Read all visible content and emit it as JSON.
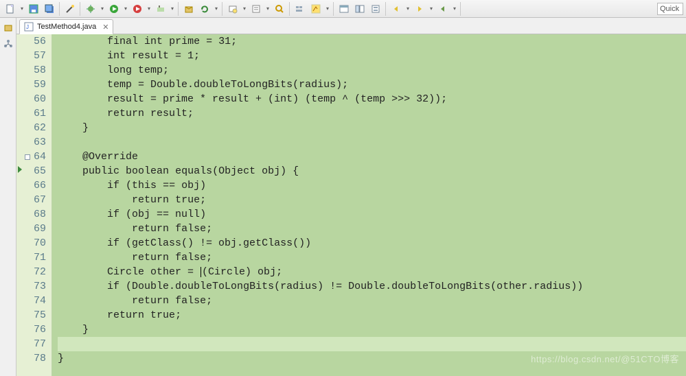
{
  "toolbar": {
    "icons": [
      "new-icon",
      "dd",
      "save-icon",
      "save-all-icon",
      "sep",
      "wand-icon",
      "sep",
      "debug-config-icon",
      "dd",
      "run-icon",
      "dd",
      "run-last-icon",
      "dd",
      "ext-tools-icon",
      "dd",
      "sep",
      "new-package-icon",
      "refresh-icon",
      "dd",
      "sep",
      "open-type-icon",
      "dd",
      "open-task-icon",
      "dd",
      "search-icon",
      "sep",
      "toggle-breadcrumb-icon",
      "highlight-icon",
      "dd",
      "sep",
      "window-icon",
      "layout-icon",
      "outline-icon",
      "sep",
      "back-icon",
      "dd",
      "forward-icon",
      "dd",
      "nav-back-icon",
      "dd",
      "sep"
    ],
    "quick_label": "Quick"
  },
  "leftStrip": [
    "package-explorer-icon",
    "type-hierarchy-icon"
  ],
  "tab": {
    "filename": "TestMethod4.java",
    "close_tooltip": "Close"
  },
  "editor": {
    "lines": [
      {
        "n": 56,
        "t": "        <kw>final</kw> <kw>int</kw> prime = 31;"
      },
      {
        "n": 57,
        "t": "        <kw>int</kw> result = 1;"
      },
      {
        "n": 58,
        "t": "        <kw>long</kw> temp;"
      },
      {
        "n": 59,
        "t": "        temp = Double.<mi>doubleToLongBits</mi>(<ident>radius</ident>);"
      },
      {
        "n": 60,
        "t": "        result = prime * result + (<kw>int</kw>) (temp ^ (temp &gt;&gt;&gt; 32));"
      },
      {
        "n": 61,
        "t": "        <kw>return</kw> result;"
      },
      {
        "n": 62,
        "t": "    }"
      },
      {
        "n": 63,
        "t": ""
      },
      {
        "n": 64,
        "t": "    <ann>@Override</ann>",
        "fold": true
      },
      {
        "n": 65,
        "t": "    <kw>public</kw> <kw>boolean</kw> equals(Object obj) {",
        "marker": true
      },
      {
        "n": 66,
        "t": "        <kw>if</kw> (<kw>this</kw> == obj)"
      },
      {
        "n": 67,
        "t": "            <kw>return</kw> <kw>true</kw>;"
      },
      {
        "n": 68,
        "t": "        <kw>if</kw> (obj == <kw>null</kw>)"
      },
      {
        "n": 69,
        "t": "            <kw>return</kw> <kw>false</kw>;"
      },
      {
        "n": 70,
        "t": "        <kw>if</kw> (getClass() != obj.getClass())"
      },
      {
        "n": 71,
        "t": "            <kw>return</kw> <kw>false</kw>;"
      },
      {
        "n": 72,
        "t": "        Circle other = <span class='cursor-caret'></span>(Circle) obj;"
      },
      {
        "n": 73,
        "t": "        <kw>if</kw> (Double.<mi>doubleToLongBits</mi>(<ident>radius</ident>) != Double.<mi>doubleToLongBits</mi>(other.<ident>radius</ident>))"
      },
      {
        "n": 74,
        "t": "            <kw>return</kw> <kw>false</kw>;"
      },
      {
        "n": 75,
        "t": "        <kw>return</kw> <kw>true</kw>;"
      },
      {
        "n": 76,
        "t": "    }"
      },
      {
        "n": 77,
        "t": "",
        "current": true
      },
      {
        "n": 78,
        "t": "}"
      }
    ]
  },
  "watermark": "https://blog.csdn.net/@51CTO博客"
}
